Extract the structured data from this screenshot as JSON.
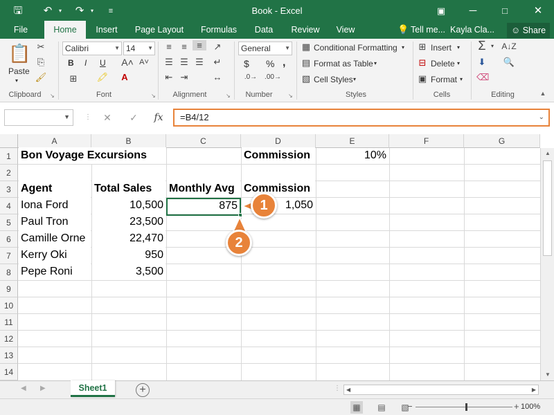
{
  "window": {
    "title": "Book - Excel",
    "user": "Kayla Cla...",
    "tell_me": "Tell me...",
    "share": "Share"
  },
  "tabs": [
    "File",
    "Home",
    "Insert",
    "Page Layout",
    "Formulas",
    "Data",
    "Review",
    "View"
  ],
  "active_tab": "Home",
  "ribbon": {
    "clipboard": {
      "label": "Clipboard",
      "paste": "Paste"
    },
    "font": {
      "label": "Font",
      "name": "Calibri",
      "size": "14",
      "bold": "B",
      "italic": "I",
      "underline": "U"
    },
    "alignment": {
      "label": "Alignment"
    },
    "number": {
      "label": "Number",
      "format": "General",
      "currency": "$",
      "percent": "%",
      "comma": ","
    },
    "styles": {
      "label": "Styles",
      "conditional_formatting": "Conditional Formatting",
      "format_as_table": "Format as Table",
      "cell_styles": "Cell Styles"
    },
    "cells": {
      "label": "Cells",
      "insert": "Insert",
      "delete": "Delete",
      "format": "Format"
    },
    "editing": {
      "label": "Editing"
    }
  },
  "formula_bar": {
    "name_box": "",
    "formula": "=B4/12",
    "fx": "fx"
  },
  "columns": [
    "A",
    "B",
    "C",
    "D",
    "E",
    "F",
    "G"
  ],
  "rows": [
    "1",
    "2",
    "3",
    "4",
    "5",
    "6",
    "7",
    "8",
    "9",
    "10",
    "11",
    "12",
    "13",
    "14"
  ],
  "cells": {
    "A1": "Bon Voyage Excursions",
    "D1": "Commission",
    "E1": "10%",
    "A3": "Agent",
    "B3": "Total Sales",
    "C3": "Monthly Avg",
    "D3": "Commission",
    "A4": "Iona Ford",
    "B4": "10,500",
    "C4": "875",
    "D4": "1,050",
    "A5": "Paul Tron",
    "B5": "23,500",
    "A6": "Camille  Orne",
    "B6": "22,470",
    "A7": "Kerry Oki",
    "B7": "950",
    "A8": "Pepe Roni",
    "B8": "3,500"
  },
  "callouts": [
    "1",
    "2"
  ],
  "sheets": [
    "Sheet1"
  ],
  "status": {
    "zoom": "100%"
  }
}
